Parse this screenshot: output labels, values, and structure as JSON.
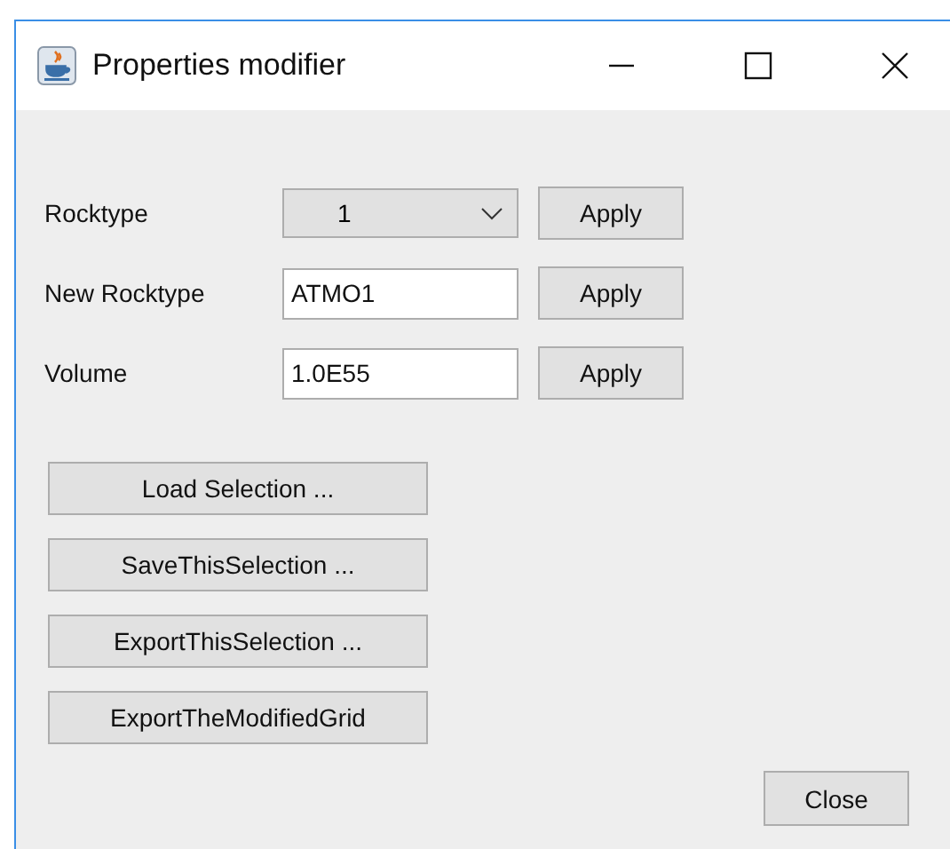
{
  "window": {
    "title": "Properties modifier"
  },
  "rows": [
    {
      "label": "Rocktype",
      "kind": "combo",
      "value": "1",
      "button": "Apply"
    },
    {
      "label": "New Rocktype",
      "kind": "text",
      "value": "ATMO1",
      "button": "Apply"
    },
    {
      "label": "Volume",
      "kind": "text",
      "value": "1.0E55",
      "button": "Apply"
    }
  ],
  "actions": [
    "Load Selection ...",
    "SaveThisSelection ...",
    "ExportThisSelection ...",
    "ExportTheModifiedGrid"
  ],
  "close_button": "Close"
}
